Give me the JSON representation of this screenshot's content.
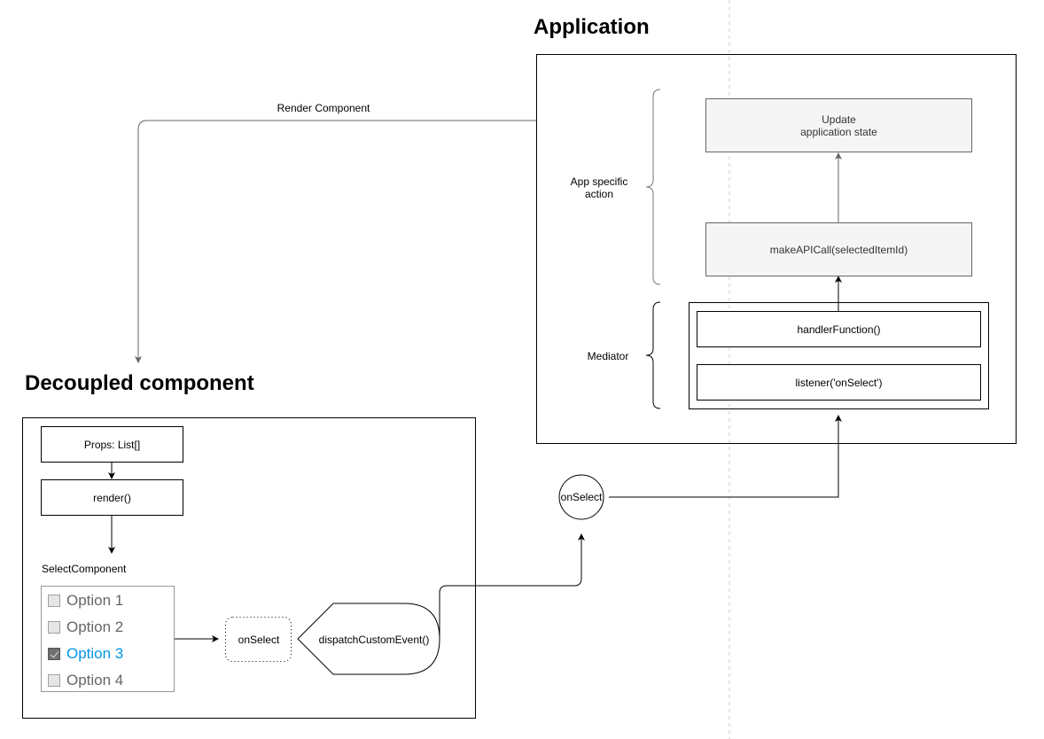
{
  "titles": {
    "application": "Application",
    "decoupled": "Decoupled component"
  },
  "application": {
    "update_state": [
      "Update",
      "application state"
    ],
    "make_api_call": "makeAPICall(selectedItemId)",
    "handler_function": "handlerFunction()",
    "listener": "listener('onSelect')",
    "brace_app_specific": [
      "App specific",
      "action"
    ],
    "brace_mediator": "Mediator"
  },
  "edges": {
    "render_component": "Render Component"
  },
  "event_node": {
    "label": "onSelect"
  },
  "component": {
    "props": "Props: List[]",
    "render": "render()",
    "select_label": "SelectComponent",
    "options": [
      {
        "label": "Option 1",
        "checked": false
      },
      {
        "label": "Option 2",
        "checked": false
      },
      {
        "label": "Option 3",
        "checked": true
      },
      {
        "label": "Option 4",
        "checked": false
      }
    ],
    "on_select": "onSelect",
    "dispatch": "dispatchCustomEvent()"
  },
  "colors": {
    "selected_option": "#0095e6",
    "gray_box_fill": "#f5f5f5",
    "connector_gray": "#666666",
    "divider": "#cccccc"
  }
}
